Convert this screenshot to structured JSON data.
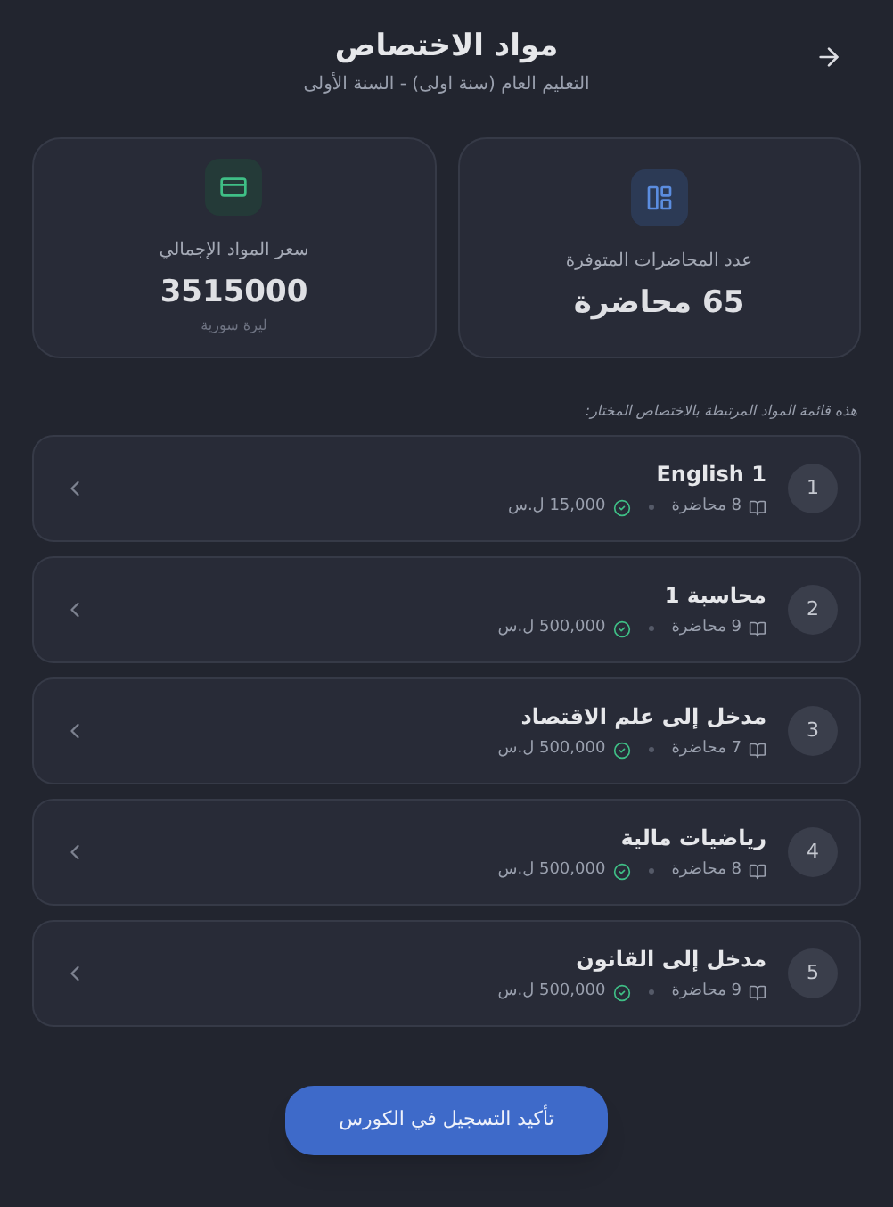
{
  "header": {
    "title": "مواد الاختصاص",
    "subtitle": "التعليم العام (سنة اولى) - السنة الأولى"
  },
  "stats": [
    {
      "kind": "lectures",
      "label": "عدد المحاضرات المتوفرة",
      "value": "65 محاضرة"
    },
    {
      "kind": "price",
      "label": "سعر المواد الإجمالي",
      "value": "3515000",
      "unit": "ليرة سورية"
    }
  ],
  "note": "هذه قائمة المواد المرتبطة بالاختصاص المختار:",
  "subjects": [
    {
      "number": "1",
      "name": "English 1",
      "lectures": "8 محاضرة",
      "price": "15,000 ل.س"
    },
    {
      "number": "2",
      "name": "محاسبة 1",
      "lectures": "9 محاضرة",
      "price": "500,000 ل.س"
    },
    {
      "number": "3",
      "name": "مدخل إلى علم الاقتصاد",
      "lectures": "7 محاضرة",
      "price": "500,000 ل.س"
    },
    {
      "number": "4",
      "name": "رياضيات مالية",
      "lectures": "8 محاضرة",
      "price": "500,000 ل.س"
    },
    {
      "number": "5",
      "name": "مدخل إلى القانون",
      "lectures": "9 محاضرة",
      "price": "500,000 ل.س"
    }
  ],
  "button": "تأكيد التسجيل في الكورس"
}
